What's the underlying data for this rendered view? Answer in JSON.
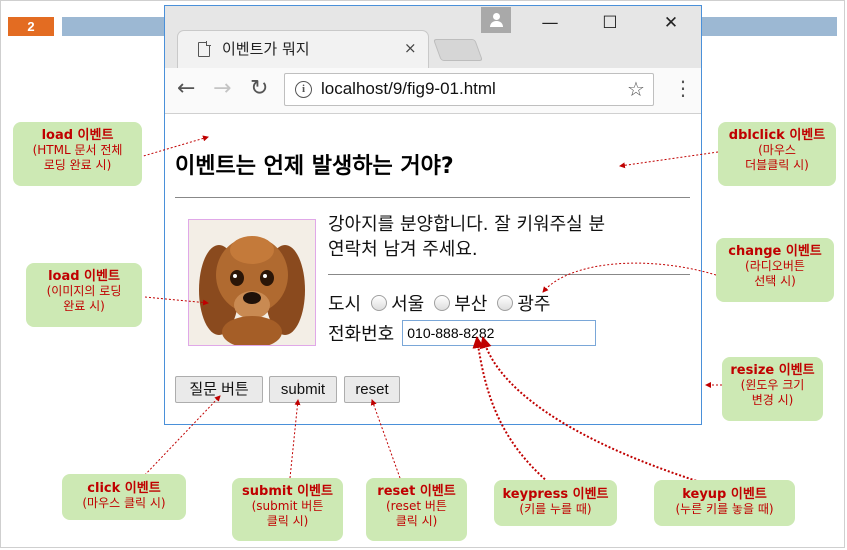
{
  "slide": {
    "number": "2"
  },
  "browser": {
    "tab_title": "이벤트가 뭐지",
    "tab_close": "×",
    "url": "localhost/9/fig9-01.html",
    "window_controls": {
      "minimize": "—",
      "maximize": "☐",
      "close": "✕"
    },
    "nav": {
      "back": "←",
      "forward": "→",
      "reload": "↻"
    },
    "icons": [
      "page-icon",
      "user-icon",
      "info-icon",
      "star-icon",
      "menu-icon"
    ],
    "star": "☆",
    "menu": "⋮",
    "info": "i"
  },
  "page": {
    "heading": "이벤트는 언제 발생하는 거야?",
    "paragraph_line1": "강아지를 분양합니다. 잘 키워주실 분",
    "paragraph_line2": "연락처 남겨 주세요.",
    "city_label": "도시",
    "cities": [
      "서울",
      "부산",
      "광주"
    ],
    "phone_label": "전화번호",
    "phone_value": "010-888-8282",
    "buttons": {
      "question": "질문 버튼",
      "submit": "submit",
      "reset": "reset"
    }
  },
  "callouts": {
    "load_page": {
      "title": "load 이벤트",
      "desc1": "(HTML 문서 전체",
      "desc2": "로딩 완료 시)"
    },
    "load_image": {
      "title": "load 이벤트",
      "desc1": "(이미지의 로딩",
      "desc2": "완료 시)"
    },
    "dblclick": {
      "title": "dblclick 이벤트",
      "desc1": "(마우스",
      "desc2": "더블클릭 시)"
    },
    "change": {
      "title": "change 이벤트",
      "desc1": "(라디오버튼",
      "desc2": "선택 시)"
    },
    "resize": {
      "title": "resize 이벤트",
      "desc1": "(윈도우 크기",
      "desc2": "변경 시)"
    },
    "click": {
      "title": "click 이벤트",
      "desc1": "(마우스 클릭 시)"
    },
    "submit": {
      "title": "submit 이벤트",
      "desc1": "(submit 버튼",
      "desc2": "클릭 시)"
    },
    "reset": {
      "title": "reset 이벤트",
      "desc1": "(reset 버튼",
      "desc2": "클릭 시)"
    },
    "keypress": {
      "title": "keypress 이벤트",
      "desc1": "(키를 누를 때)"
    },
    "keyup": {
      "title": "keyup 이벤트",
      "desc1": "(누른 키를 놓을 때)"
    }
  },
  "colors": {
    "callout_bg": "#cde9b4",
    "callout_text": "#c00000",
    "slide_num_bg": "#e36c22",
    "slide_bar": "#9cb8d3",
    "arrow": "#c00000"
  }
}
